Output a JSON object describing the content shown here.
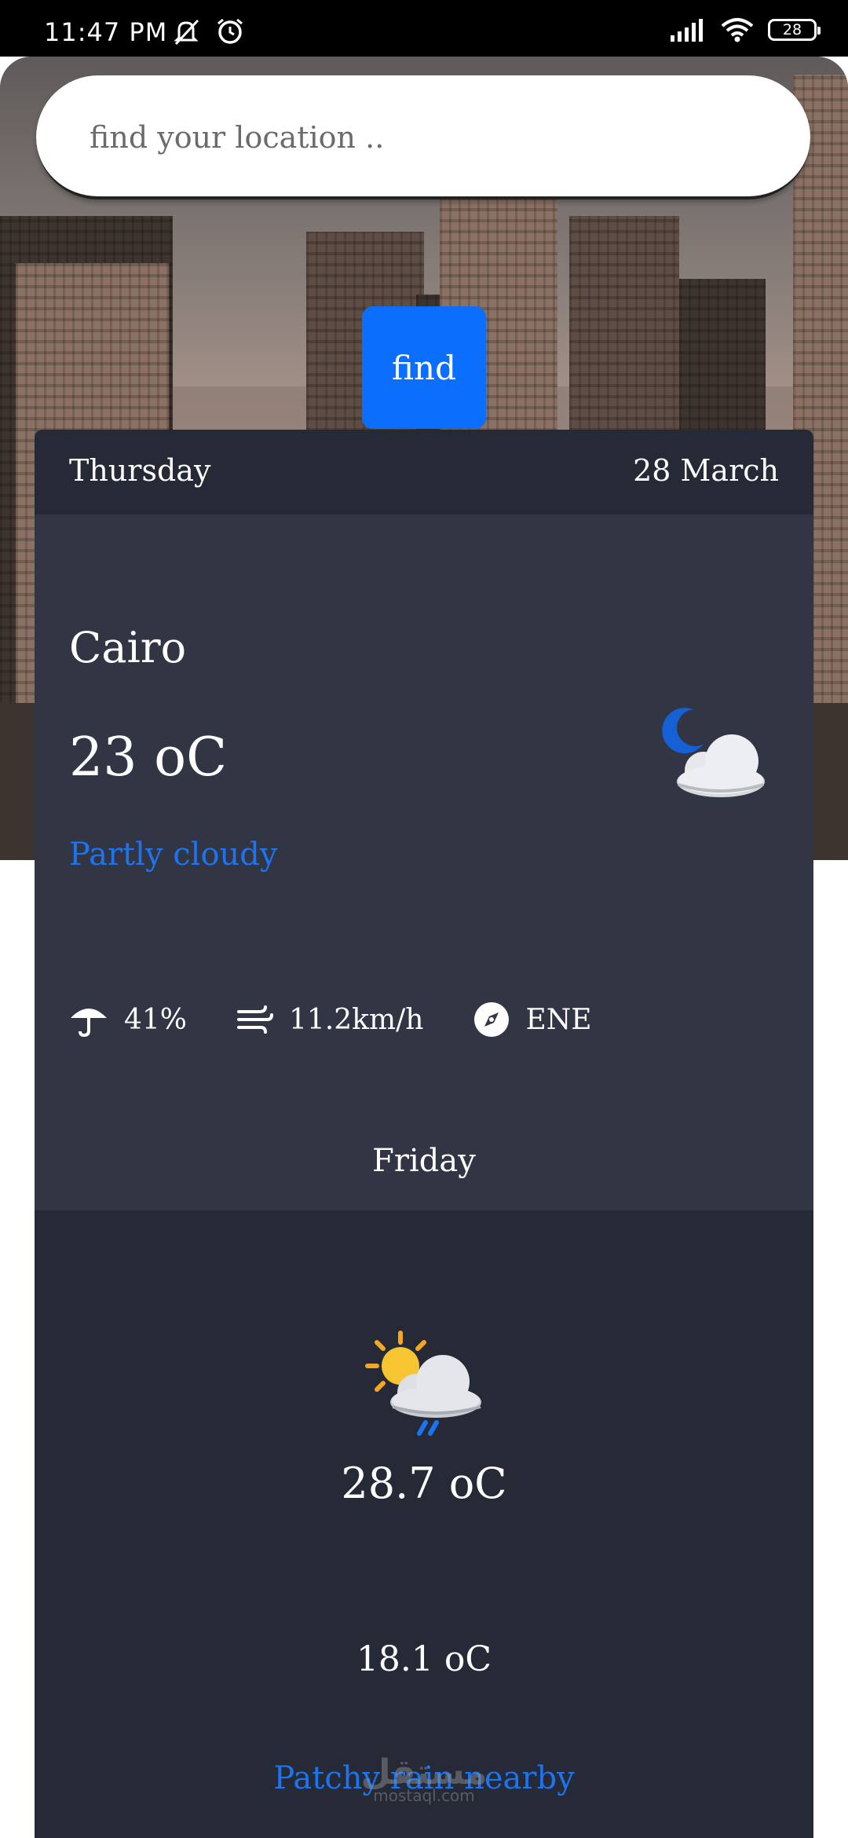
{
  "status_bar": {
    "time": "11:47 PM",
    "battery": "28",
    "icons": [
      "mute-icon",
      "alarm-icon",
      "signal-icon",
      "wifi-icon",
      "battery-icon"
    ]
  },
  "search": {
    "placeholder": "find your location ..",
    "button_label": "find"
  },
  "today": {
    "day": "Thursday",
    "date": "28 March",
    "city": "Cairo",
    "temperature": "23 oC",
    "condition": "Partly cloudy",
    "icon": "night-partly-cloudy-icon",
    "humidity": "41%",
    "wind_speed": "11.2km/h",
    "wind_direction": "ENE"
  },
  "forecast": {
    "day": "Friday",
    "icon": "sun-cloud-rain-icon",
    "max_temp": "28.7 oC",
    "min_temp": "18.1 oC",
    "condition": "Patchy rain nearby"
  },
  "watermark": {
    "main": "مستقل",
    "sub": "mostaql.com"
  },
  "colors": {
    "accent": "#0b6efd",
    "condition_text": "#1b74f2",
    "card_dark": "#262a36",
    "card_mid": "#323644"
  }
}
